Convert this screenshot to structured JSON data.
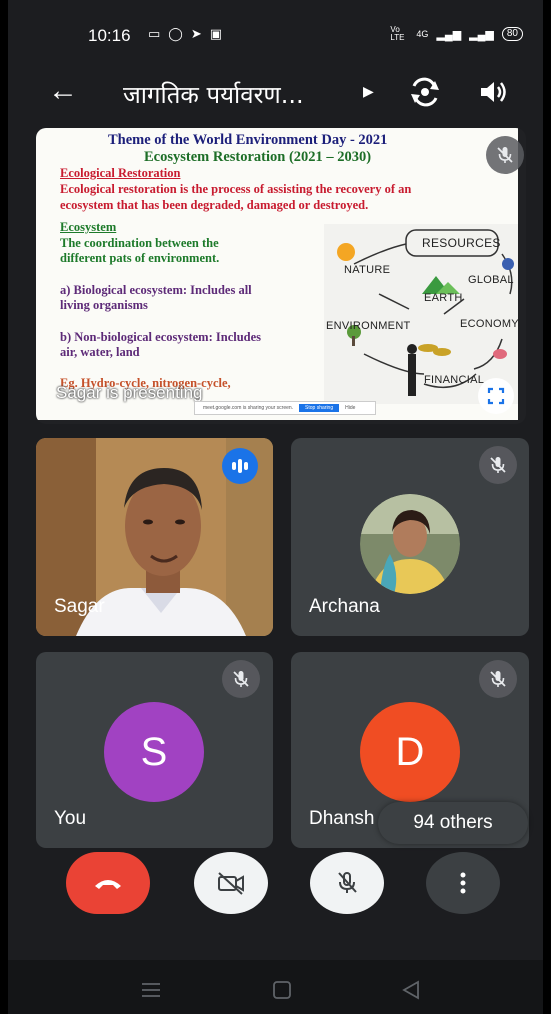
{
  "status_bar": {
    "time": "10:16",
    "network_text": "Vo LTE",
    "signal_text": "4G",
    "battery": "80"
  },
  "header": {
    "title": "जागतिक पर्यावरण..."
  },
  "presentation": {
    "presenter_label": "Sagar is presenting",
    "share_bar_text": "meet.google.com is sharing your screen.",
    "share_stop_label": "Stop sharing",
    "share_hide_label": "Hide",
    "slide": {
      "title_line1": "Theme of the World Environment Day - 2021",
      "title_line2": "Ecosystem Restoration (2021 – 2030)",
      "heading1": "Ecological Restoration",
      "para1_line1": "Ecological restoration is the process of assisting the recovery of an",
      "para1_line2": "ecosystem that has been degraded, damaged or destroyed.",
      "heading2": "Ecosystem",
      "para2_line1": "The coordination between the",
      "para2_line2": "different pats of environment.",
      "item_a_line1": "a) Biological ecosystem: Includes all",
      "item_a_line2": "living organisms",
      "item_b_line1": "b) Non-biological ecosystem: Includes",
      "item_b_line2": "air, water, land",
      "item_c": "Eg. Hydro-cycle, nitrogen-cycle,",
      "diagram": {
        "resources": "RESOURCES",
        "nature": "NATURE",
        "earth": "EARTH",
        "global": "GLOBAL",
        "environment": "ENVIRONMENT",
        "economy": "ECONOMY",
        "financial": "FINANCIAL"
      }
    }
  },
  "participants": [
    {
      "name": "Sagar",
      "state": "speaking",
      "kind": "video"
    },
    {
      "name": "Archana",
      "state": "muted",
      "kind": "photo"
    },
    {
      "name": "You",
      "state": "muted",
      "kind": "letter",
      "letter": "S",
      "color": "#a142c2"
    },
    {
      "name": "Dhansh",
      "state": "muted",
      "kind": "letter",
      "letter": "D",
      "color": "#f04d23"
    }
  ],
  "others_label": "94 others",
  "colors": {
    "end_call": "#ea4335",
    "speaking_badge": "#1a73e8",
    "tile_bg": "#3c4043"
  }
}
